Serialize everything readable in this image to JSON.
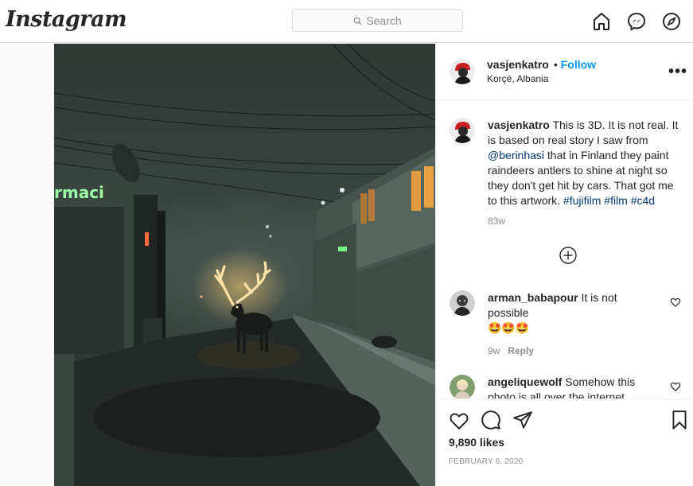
{
  "header": {
    "logo": "Instagram",
    "search_placeholder": "Search",
    "nav_icons": [
      "home-icon",
      "messenger-icon",
      "explore-icon"
    ]
  },
  "post": {
    "author": "vasjenkatro",
    "follow_label": "Follow",
    "location": "Korçë, Albania",
    "caption": {
      "username": "vasjenkatro",
      "text1": "This is 3D. It is not real. It is based on real story I saw from ",
      "mention": "@berinhasi",
      "text2": " that in Finland they paint raindeers antlers to shine at night so they don't get hit by cars. That got me to this artwork. ",
      "hashtags": [
        "#fujifilm",
        "#film",
        "#c4d"
      ],
      "age": "83w"
    },
    "comments": [
      {
        "username": "arman_babapour",
        "text": "It is not possible",
        "emoji": "🤩🤩🤩",
        "age": "9w",
        "reply": "Reply"
      },
      {
        "username": "angeliquewolf",
        "text": "Somehow this photo is all over the internet"
      }
    ],
    "likes": "9,890 likes",
    "date": "FEBRUARY 6, 2020",
    "sign_text": "rmaci"
  },
  "colors": {
    "accent": "#0095f6",
    "link": "#00376b",
    "muted": "#8e8e8e",
    "border": "#dbdbdb"
  }
}
